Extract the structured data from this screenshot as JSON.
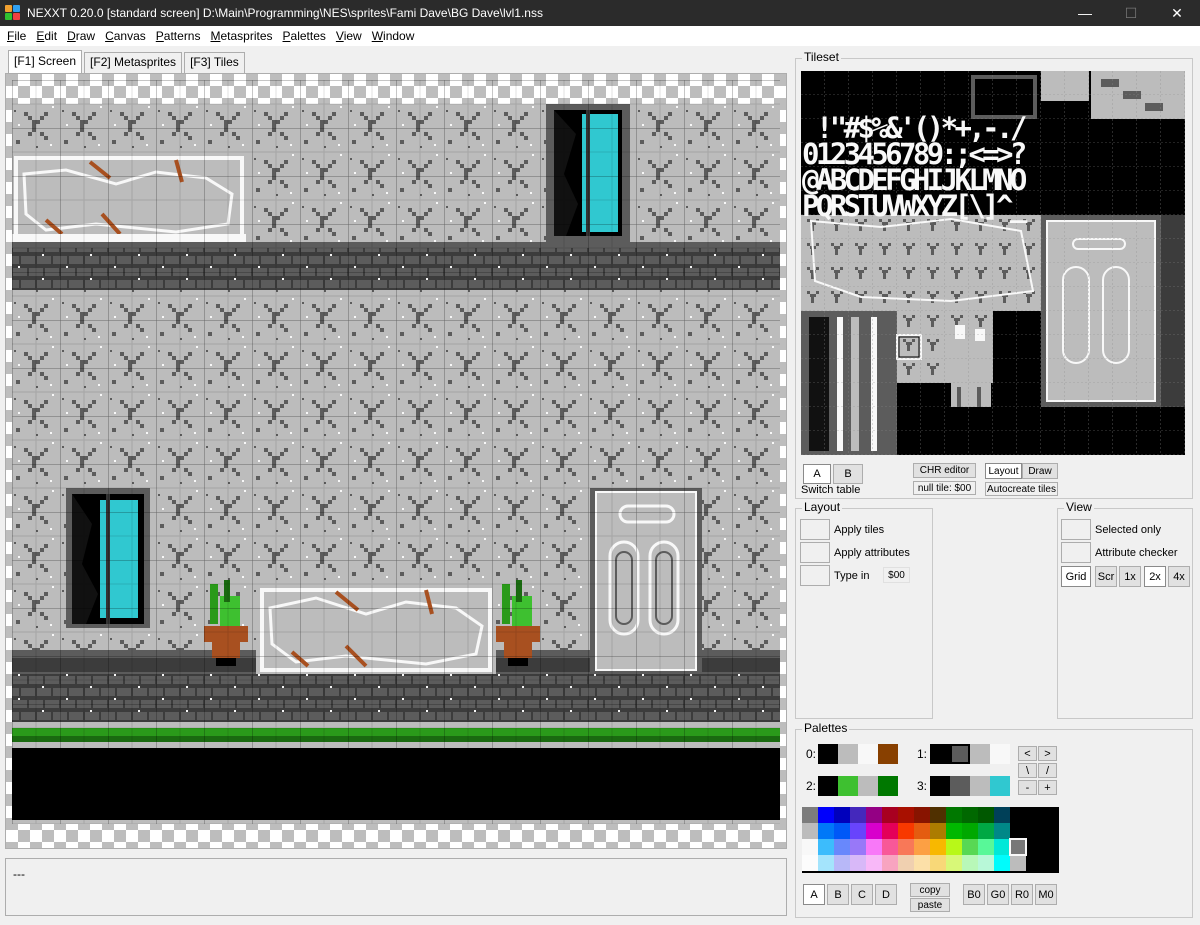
{
  "window": {
    "title": "NEXXT 0.20.0  [standard screen] D:\\Main\\Programming\\NES\\sprites\\Fami Dave\\BG Dave\\lvl1.nss",
    "minimize": "—",
    "maximize": "☐",
    "close": "✕"
  },
  "menu": [
    {
      "u": "F",
      "rest": "ile"
    },
    {
      "u": "E",
      "rest": "dit"
    },
    {
      "u": "D",
      "rest": "raw"
    },
    {
      "u": "C",
      "rest": "anvas"
    },
    {
      "u": "P",
      "rest": "atterns"
    },
    {
      "u": "M",
      "rest": "etasprites"
    },
    {
      "u": "P",
      "rest": "alettes"
    },
    {
      "u": "V",
      "rest": "iew"
    },
    {
      "u": "W",
      "rest": "indow"
    }
  ],
  "tabs": [
    "[F1] Screen",
    "[F2] Metasprites",
    "[F3] Tiles"
  ],
  "status": "---",
  "tileset": {
    "label": "Tileset",
    "text_rows": [
      " !\"#$%&'()*+,-./",
      "0123456789:;<=>?",
      "@ABCDEFGHIJKLMNO",
      "PQRSTUVWXYZ[\\]^_"
    ],
    "table_a": "A",
    "table_b": "B",
    "switch_table": "Switch table",
    "chr_editor": "CHR editor",
    "null_tile": "null tile: $00",
    "layout": "Layout",
    "draw": "Draw",
    "autocreate": "Autocreate tiles"
  },
  "layout_group": {
    "label": "Layout",
    "apply_tiles": "Apply tiles",
    "apply_attributes": "Apply attributes",
    "type_in": "Type in",
    "type_in_value": "$00"
  },
  "view_group": {
    "label": "View",
    "selected_only": "Selected only",
    "attribute_checker": "Attribute checker",
    "grid": "Grid",
    "scr": "Scr",
    "x1": "1x",
    "x2": "2x",
    "x4": "4x"
  },
  "palettes": {
    "label": "Palettes",
    "sets": [
      {
        "label": "0:",
        "colors": [
          "#000000",
          "#bcbcbc",
          "#f8f8f8",
          "#884000"
        ]
      },
      {
        "label": "1:",
        "colors": [
          "#000000",
          "#5c5c5c",
          "#bcbcbc",
          "#f8f8f8"
        ]
      },
      {
        "label": "2:",
        "colors": [
          "#000000",
          "#3ec030",
          "#bcbcbc",
          "#007800"
        ]
      },
      {
        "label": "3:",
        "colors": [
          "#000000",
          "#5c5c5c",
          "#bcbcbc",
          "#30c8d0"
        ]
      }
    ],
    "nav": [
      "<",
      ">",
      "\\",
      "/",
      "-",
      "+"
    ],
    "banks": [
      "A",
      "B",
      "C",
      "D"
    ],
    "copy": "copy",
    "paste": "paste",
    "modes": [
      "B0",
      "G0",
      "R0",
      "M0"
    ]
  },
  "colors": {
    "accent_dark": "#2b2b2b",
    "wall_light": "#bcbcbc",
    "wall_dark": "#5c5c5c",
    "brick": "#444444",
    "grass": "#2a9a1a",
    "water": "#30c8d0",
    "wood": "#a85020"
  }
}
